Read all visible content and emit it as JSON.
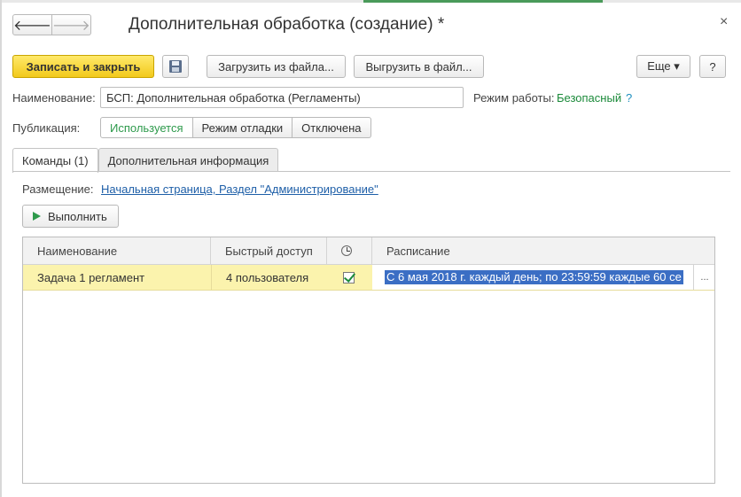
{
  "window": {
    "title": "Дополнительная обработка (создание) *",
    "close_glyph": "×",
    "nav_back_glyph": "🡐",
    "nav_forward_glyph": "🡒"
  },
  "toolbar": {
    "save_close_label": "Записать и закрыть",
    "load_file_label": "Загрузить из файла...",
    "unload_file_label": "Выгрузить в файл...",
    "more_label": "Еще ▾",
    "help_label": "?"
  },
  "form": {
    "name_label": "Наименование:",
    "name_value": "БСП: Дополнительная обработка (Регламенты)",
    "mode_label": "Режим работы:",
    "mode_value": "Безопасный",
    "mode_help": "?",
    "publication_label": "Публикация:",
    "publication_options": [
      "Используется",
      "Режим отладки",
      "Отключена"
    ]
  },
  "tabs": [
    {
      "label": "Команды (1)"
    },
    {
      "label": "Дополнительная информация"
    }
  ],
  "commands": {
    "placement_label": "Размещение:",
    "placement_link": "Начальная страница, Раздел \"Администрирование\"",
    "run_label": "Выполнить"
  },
  "grid": {
    "columns": [
      "Наименование",
      "Быстрый доступ",
      "",
      "Расписание"
    ],
    "rows": [
      {
        "name": "Задача 1 регламент",
        "quick_access": "4 пользователя",
        "scheduled": true,
        "schedule": "С 6 мая 2018 г. каждый день; по 23:59:59 каждые 60 се"
      }
    ],
    "ellipsis": "..."
  },
  "colors": {
    "primary_button": "#f2c91b",
    "active_segment_text": "#2e9a4c",
    "link": "#1e5fa8",
    "selected_row": "#fbf3ad",
    "selection": "#3b6ec4"
  }
}
